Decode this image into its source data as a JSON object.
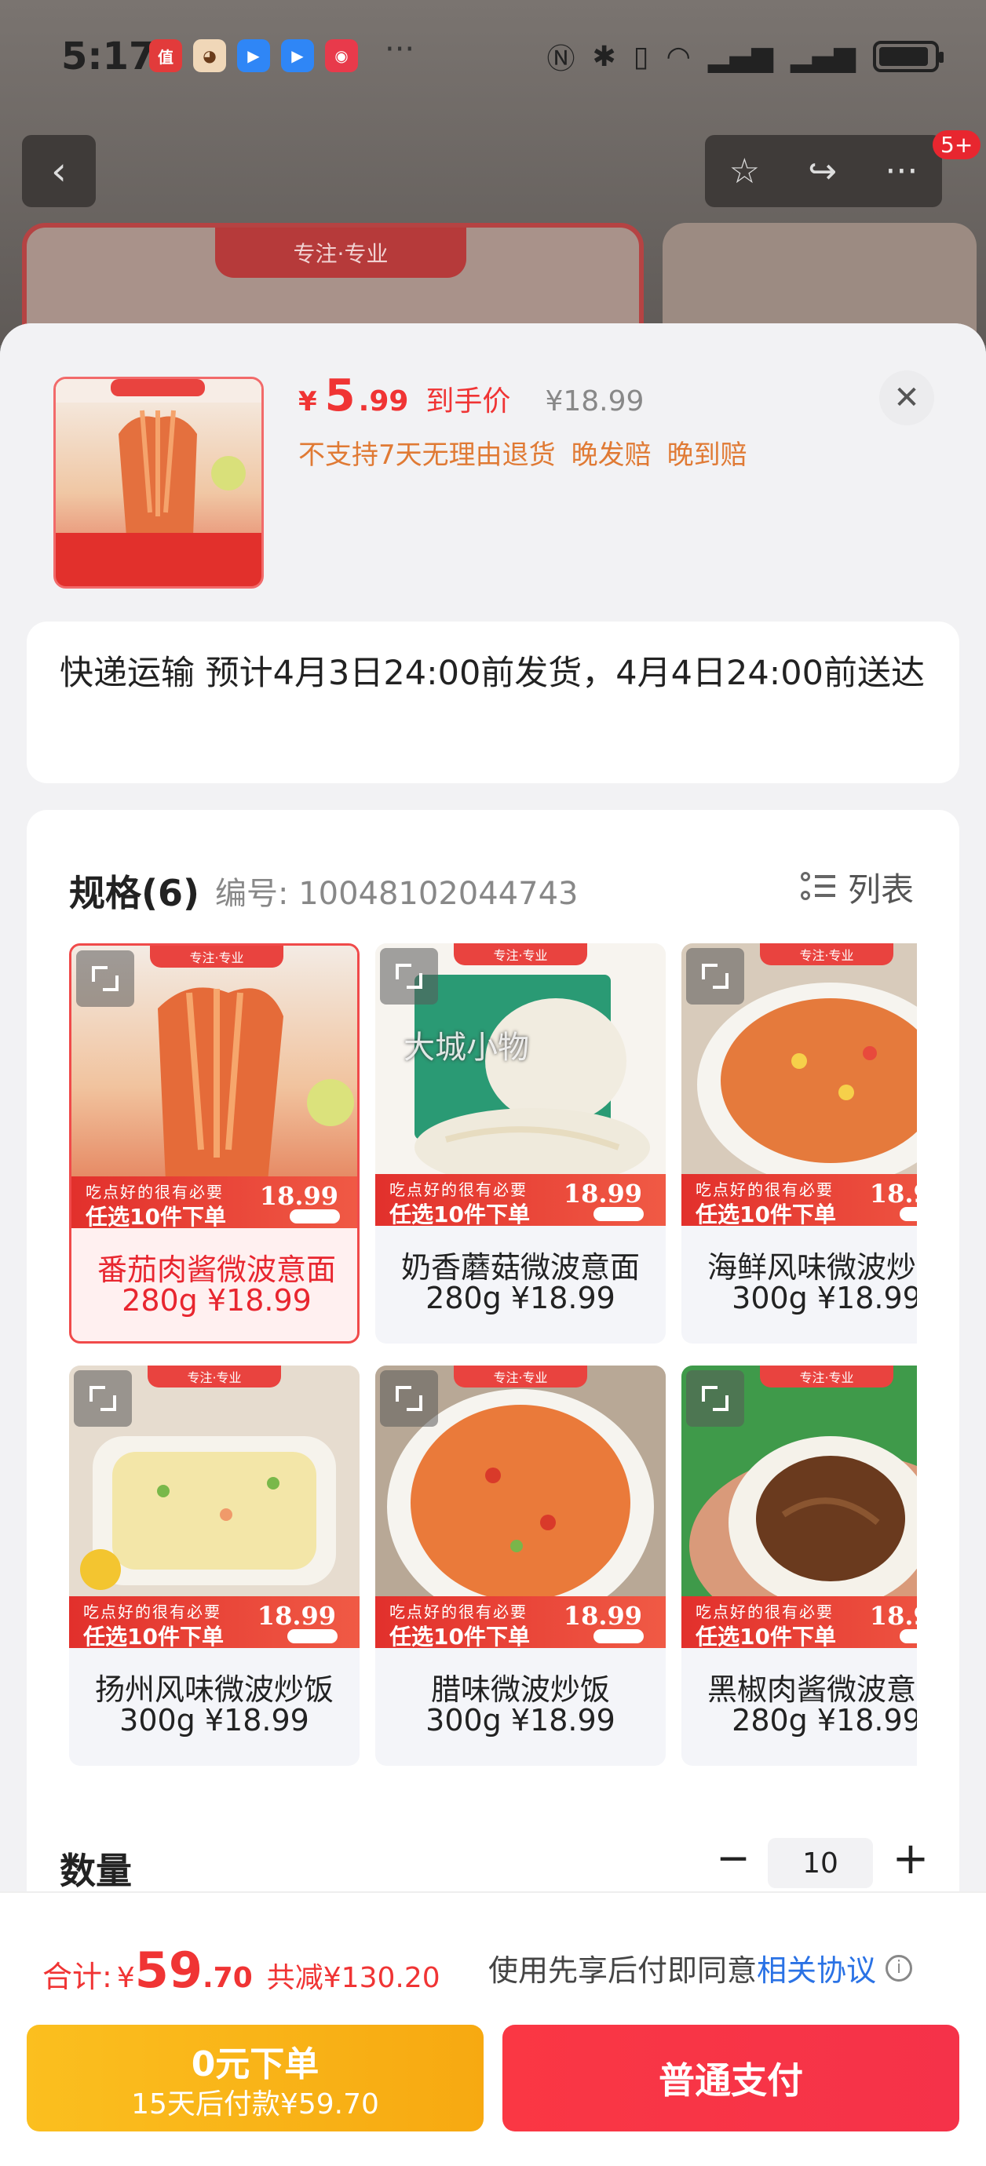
{
  "status_bar": {
    "time": "5:17",
    "dots": "···",
    "icons": [
      "nfc-icon",
      "bluetooth-icon",
      "vibrate-icon",
      "wifi-icon",
      "signal-icon",
      "signal-icon",
      "battery-charging-icon"
    ]
  },
  "background": {
    "badge": "5+",
    "card_tab": "专注·专业"
  },
  "product": {
    "price_symbol": "¥",
    "price_int": "5",
    "price_dec": ".99",
    "price_label": "到手价",
    "original_price": "¥18.99",
    "tags": [
      "不支持7天无理由退货",
      "晚发赔",
      "晚到赔"
    ]
  },
  "shipping": {
    "text": "快递运输 预计4月3日24:00前发货，4月4日24:00前送达"
  },
  "spec": {
    "title": "规格(6)",
    "code_label": "编号: 10048102044743",
    "list_label": "列表",
    "items": [
      {
        "name": "番茄肉酱微波意面",
        "price": "280g ¥18.99",
        "selected": true
      },
      {
        "name": "奶香蘑菇微波意面",
        "price": "280g ¥18.99",
        "selected": false
      },
      {
        "name": "海鲜风味微波炒饭",
        "price": "300g ¥18.99",
        "selected": false
      },
      {
        "name": "扬州风味微波炒饭",
        "price": "300g ¥18.99",
        "selected": false
      },
      {
        "name": "腊味微波炒饭",
        "price": "300g ¥18.99",
        "selected": false
      },
      {
        "name": "黑椒肉酱微波意面",
        "price": "280g ¥18.99",
        "selected": false
      }
    ],
    "promo": {
      "ribbon": "专注·专业",
      "top": "吃点好的很有必要",
      "main": "任选10件下单",
      "price": "18.99"
    },
    "watermark": "大城小物"
  },
  "quantity": {
    "label": "数量",
    "minus": "−",
    "value": "10",
    "plus": "+"
  },
  "footer": {
    "total_label": "合计:",
    "total_symbol": "¥",
    "total_int": "59",
    "total_dec": ".70",
    "discount": "共减¥130.20",
    "agree_text": "使用先享后付即同意",
    "agree_link": "相关协议",
    "info": "i",
    "zero_btn_main": "0元下单",
    "zero_btn_sub": "15天后付款¥59.70",
    "pay_btn": "普通支付"
  },
  "colors": {
    "accent": "#f03434",
    "discount_tags": "#e07a34",
    "link": "#2a72e5",
    "zero_btn": "#fbbf1f",
    "pay_btn": "#fa3744"
  }
}
